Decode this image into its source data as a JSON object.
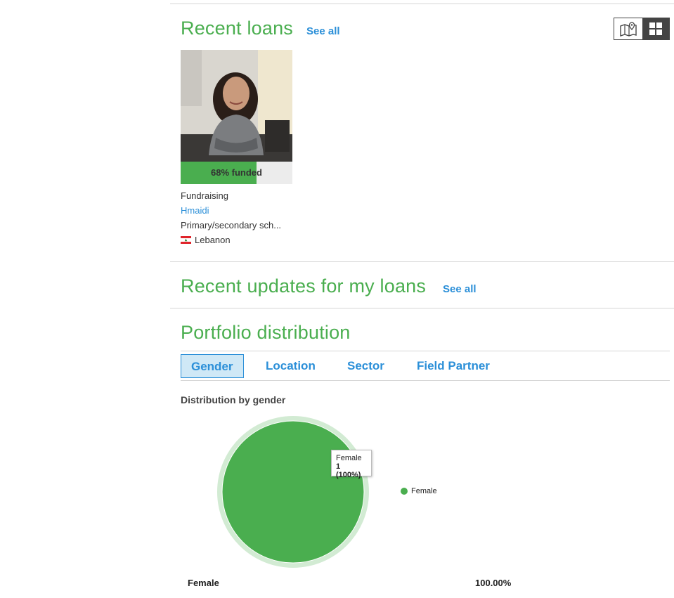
{
  "recent_loans": {
    "title": "Recent loans",
    "see_all": "See all",
    "loan": {
      "funded_fraction": 0.68,
      "funded_label": "68% funded",
      "status": "Fundraising",
      "borrower": "Hmaidi",
      "sector": "Primary/secondary sch...",
      "country": "Lebanon"
    }
  },
  "view_toggle": {
    "map_icon": "map-pin-icon",
    "grid_icon": "grid-icon"
  },
  "recent_updates": {
    "title": "Recent updates for my loans",
    "see_all": "See all"
  },
  "portfolio": {
    "title": "Portfolio distribution",
    "tabs": [
      {
        "label": "Gender",
        "active": true
      },
      {
        "label": "Location",
        "active": false
      },
      {
        "label": "Sector",
        "active": false
      },
      {
        "label": "Field Partner",
        "active": false
      }
    ],
    "subtitle": "Distribution by gender",
    "table": [
      {
        "label": "Female",
        "value": "100.00%"
      }
    ]
  },
  "colors": {
    "green": "#4aae4f",
    "blue": "#2b8fd8"
  },
  "chart_data": {
    "type": "pie",
    "title": "",
    "slices": [
      {
        "label": "Female",
        "value": 1,
        "percent": 100,
        "color": "#4aae4f"
      }
    ],
    "tooltip": {
      "label": "Female",
      "value": "1 (100%)"
    },
    "legend": {
      "position": "right",
      "entries": [
        "Female"
      ]
    }
  }
}
